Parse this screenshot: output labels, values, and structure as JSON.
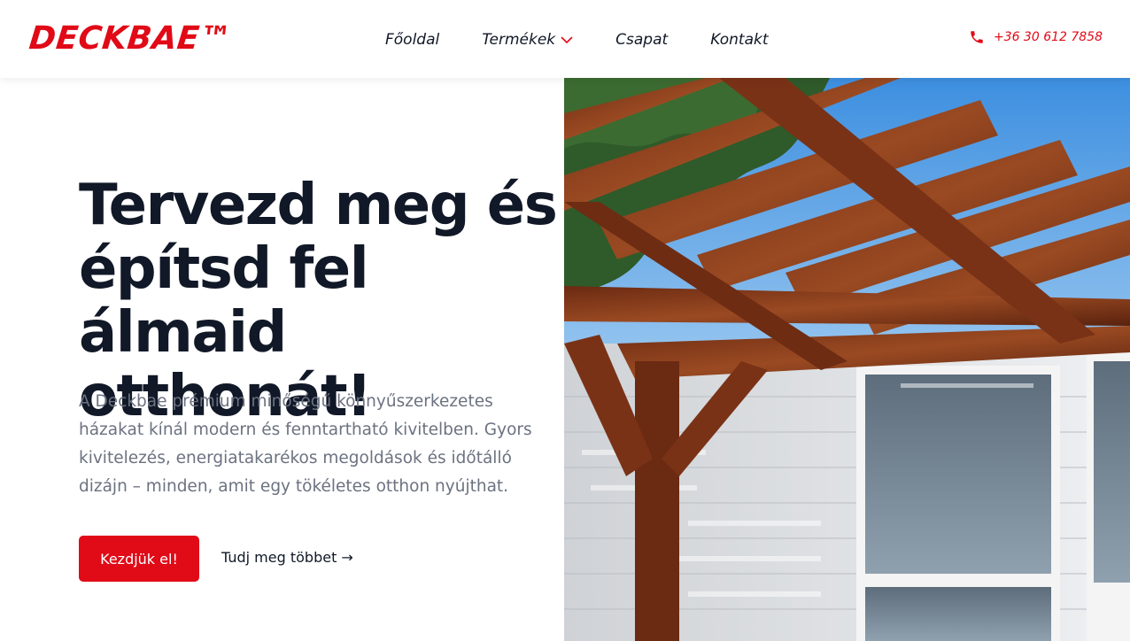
{
  "brand": {
    "logo": "DECKBAE™",
    "accent_color": "#e10a17"
  },
  "nav": {
    "items": [
      {
        "label": "Főoldal"
      },
      {
        "label": "Termékek",
        "has_dropdown": true,
        "icon": "chevron-down-icon"
      },
      {
        "label": "Csapat"
      },
      {
        "label": "Kontakt"
      }
    ]
  },
  "contact": {
    "phone": "+36 30 612 7858",
    "icon": "phone-icon"
  },
  "hero": {
    "title": "Tervezd meg és építsd fel álmaid otthonát!",
    "text": "A Deckbae prémium minőségű könnyűszerkezetes házakat kínál modern és fenntartható kivitelben. Gyors kivitelezés, energiatakarékos megoldások és időtálló dizájn – minden, amit egy tökéletes otthon nyújthat.",
    "primary_button": "Kezdjük el!",
    "secondary_link": "Tudj meg többet →",
    "image": "wooden-pergola-photo"
  }
}
